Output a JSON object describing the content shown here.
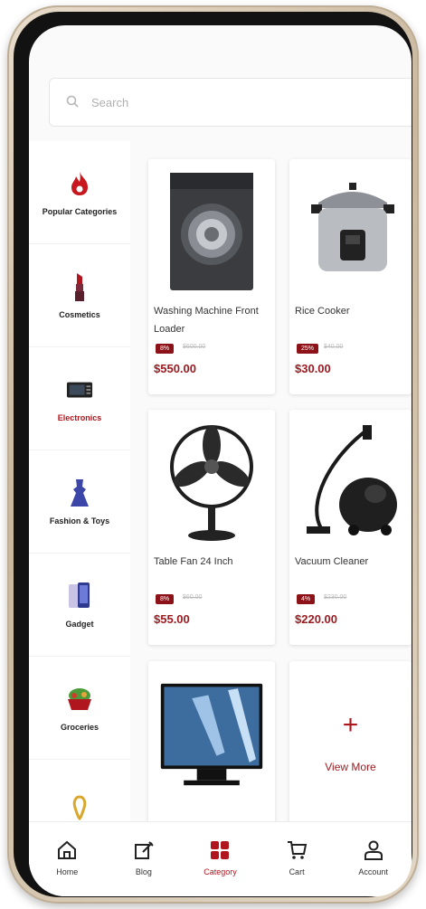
{
  "search": {
    "placeholder": "Search"
  },
  "sidebar": {
    "items": [
      {
        "label": "Popular Categories",
        "icon": "fire-icon",
        "active": false
      },
      {
        "label": "Cosmetics",
        "icon": "lipstick-icon",
        "active": false
      },
      {
        "label": "Electronics",
        "icon": "microwave-icon",
        "active": true
      },
      {
        "label": "Fashion & Toys",
        "icon": "dress-icon",
        "active": false
      },
      {
        "label": "Gadget",
        "icon": "phone-icon",
        "active": false
      },
      {
        "label": "Groceries",
        "icon": "basket-icon",
        "active": false
      },
      {
        "label": "",
        "icon": "ring-icon",
        "active": false
      }
    ]
  },
  "products": [
    {
      "name": "Washing Machine Front Loader",
      "discount": "8%",
      "old_price": "$600.00",
      "price": "$550.00",
      "icon": "washing-machine-icon"
    },
    {
      "name": "Rice Cooker",
      "discount": "25%",
      "old_price": "$40.00",
      "price": "$30.00",
      "icon": "rice-cooker-icon"
    },
    {
      "name": "Table Fan 24 Inch",
      "discount": "8%",
      "old_price": "$60.00",
      "price": "$55.00",
      "icon": "fan-icon"
    },
    {
      "name": "Vacuum Cleaner",
      "discount": "4%",
      "old_price": "$230.00",
      "price": "$220.00",
      "icon": "vacuum-icon"
    },
    {
      "name": "",
      "icon": "television-icon"
    }
  ],
  "view_more": {
    "label": "View More"
  },
  "bottom_nav": {
    "tabs": [
      {
        "label": "Home",
        "icon": "home-icon",
        "active": false
      },
      {
        "label": "Blog",
        "icon": "blog-icon",
        "active": false
      },
      {
        "label": "Category",
        "icon": "grid-icon",
        "active": true
      },
      {
        "label": "Cart",
        "icon": "cart-icon",
        "active": false
      },
      {
        "label": "Account",
        "icon": "account-icon",
        "active": false
      }
    ]
  },
  "colors": {
    "accent": "#b0161e",
    "price": "#9a1a1f",
    "badge": "#8c1218"
  }
}
